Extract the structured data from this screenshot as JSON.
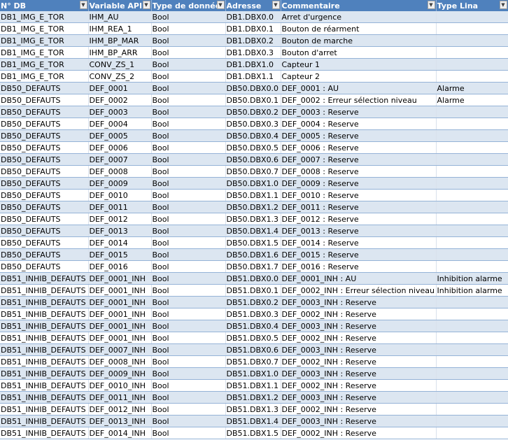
{
  "headers": [
    "N° DB",
    "Variable API",
    "Type de donnée",
    "Adresse",
    "Commentaire",
    "Type Lina"
  ],
  "rows": [
    [
      "DB1_IMG_E_TOR",
      "IHM_AU",
      "Bool",
      "DB1.DBX0.0",
      "Arret d'urgence",
      ""
    ],
    [
      "DB1_IMG_E_TOR",
      "IHM_REA_1",
      "Bool",
      "DB1.DBX0.1",
      "Bouton de réarment",
      ""
    ],
    [
      "DB1_IMG_E_TOR",
      "IHM_BP_MAR",
      "Bool",
      "DB1.DBX0.2",
      "Bouton de marche",
      ""
    ],
    [
      "DB1_IMG_E_TOR",
      "IHM_BP_ARR",
      "Bool",
      "DB1.DBX0.3",
      "Bouton d'arret",
      ""
    ],
    [
      "DB1_IMG_E_TOR",
      "CONV_ZS_1",
      "Bool",
      "DB1.DBX1.0",
      "Capteur 1",
      ""
    ],
    [
      "DB1_IMG_E_TOR",
      "CONV_ZS_2",
      "Bool",
      "DB1.DBX1.1",
      "Capteur 2",
      ""
    ],
    [
      "DB50_DEFAUTS",
      "DEF_0001",
      "Bool",
      "DB50.DBX0.0",
      "DEF_0001 : AU",
      "Alarme"
    ],
    [
      "DB50_DEFAUTS",
      "DEF_0002",
      "Bool",
      "DB50.DBX0.1",
      "DEF_0002 : Erreur sélection niveau",
      "Alarme"
    ],
    [
      "DB50_DEFAUTS",
      "DEF_0003",
      "Bool",
      "DB50.DBX0.2",
      "DEF_0003 : Reserve",
      ""
    ],
    [
      "DB50_DEFAUTS",
      "DEF_0004",
      "Bool",
      "DB50.DBX0.3",
      "DEF_0004 : Reserve",
      ""
    ],
    [
      "DB50_DEFAUTS",
      "DEF_0005",
      "Bool",
      "DB50.DBX0.4",
      "DEF_0005 : Reserve",
      ""
    ],
    [
      "DB50_DEFAUTS",
      "DEF_0006",
      "Bool",
      "DB50.DBX0.5",
      "DEF_0006 : Reserve",
      ""
    ],
    [
      "DB50_DEFAUTS",
      "DEF_0007",
      "Bool",
      "DB50.DBX0.6",
      "DEF_0007 : Reserve",
      ""
    ],
    [
      "DB50_DEFAUTS",
      "DEF_0008",
      "Bool",
      "DB50.DBX0.7",
      "DEF_0008 : Reserve",
      ""
    ],
    [
      "DB50_DEFAUTS",
      "DEF_0009",
      "Bool",
      "DB50.DBX1.0",
      "DEF_0009 : Reserve",
      ""
    ],
    [
      "DB50_DEFAUTS",
      "DEF_0010",
      "Bool",
      "DB50.DBX1.1",
      "DEF_0010 : Reserve",
      ""
    ],
    [
      "DB50_DEFAUTS",
      "DEF_0011",
      "Bool",
      "DB50.DBX1.2",
      "DEF_0011 : Reserve",
      ""
    ],
    [
      "DB50_DEFAUTS",
      "DEF_0012",
      "Bool",
      "DB50.DBX1.3",
      "DEF_0012 : Reserve",
      ""
    ],
    [
      "DB50_DEFAUTS",
      "DEF_0013",
      "Bool",
      "DB50.DBX1.4",
      "DEF_0013 : Reserve",
      ""
    ],
    [
      "DB50_DEFAUTS",
      "DEF_0014",
      "Bool",
      "DB50.DBX1.5",
      "DEF_0014 : Reserve",
      ""
    ],
    [
      "DB50_DEFAUTS",
      "DEF_0015",
      "Bool",
      "DB50.DBX1.6",
      "DEF_0015 : Reserve",
      ""
    ],
    [
      "DB50_DEFAUTS",
      "DEF_0016",
      "Bool",
      "DB50.DBX1.7",
      "DEF_0016 : Reserve",
      ""
    ],
    [
      "DB51_INHIB_DEFAUTS",
      "DEF_0001_INH",
      "Bool",
      "DB51.DBX0.0",
      "DEF_0001_INH : AU",
      "Inhibition alarme"
    ],
    [
      "DB51_INHIB_DEFAUTS",
      "DEF_0001_INH",
      "Bool",
      "DB51.DBX0.1",
      "DEF_0002_INH : Erreur sélection niveau",
      "Inhibition alarme"
    ],
    [
      "DB51_INHIB_DEFAUTS",
      "DEF_0001_INH",
      "Bool",
      "DB51.DBX0.2",
      "DEF_0003_INH : Reserve",
      ""
    ],
    [
      "DB51_INHIB_DEFAUTS",
      "DEF_0001_INH",
      "Bool",
      "DB51.DBX0.3",
      "DEF_0002_INH : Reserve",
      ""
    ],
    [
      "DB51_INHIB_DEFAUTS",
      "DEF_0001_INH",
      "Bool",
      "DB51.DBX0.4",
      "DEF_0003_INH : Reserve",
      ""
    ],
    [
      "DB51_INHIB_DEFAUTS",
      "DEF_0001_INH",
      "Bool",
      "DB51.DBX0.5",
      "DEF_0002_INH : Reserve",
      ""
    ],
    [
      "DB51_INHIB_DEFAUTS",
      "DEF_0007_INH",
      "Bool",
      "DB51.DBX0.6",
      "DEF_0003_INH : Reserve",
      ""
    ],
    [
      "DB51_INHIB_DEFAUTS",
      "DEF_0008_INH",
      "Bool",
      "DB51.DBX0.7",
      "DEF_0002_INH : Reserve",
      ""
    ],
    [
      "DB51_INHIB_DEFAUTS",
      "DEF_0009_INH",
      "Bool",
      "DB51.DBX1.0",
      "DEF_0003_INH : Reserve",
      ""
    ],
    [
      "DB51_INHIB_DEFAUTS",
      "DEF_0010_INH",
      "Bool",
      "DB51.DBX1.1",
      "DEF_0002_INH : Reserve",
      ""
    ],
    [
      "DB51_INHIB_DEFAUTS",
      "DEF_0011_INH",
      "Bool",
      "DB51.DBX1.2",
      "DEF_0003_INH : Reserve",
      ""
    ],
    [
      "DB51_INHIB_DEFAUTS",
      "DEF_0012_INH",
      "Bool",
      "DB51.DBX1.3",
      "DEF_0002_INH : Reserve",
      ""
    ],
    [
      "DB51_INHIB_DEFAUTS",
      "DEF_0013_INH",
      "Bool",
      "DB51.DBX1.4",
      "DEF_0003_INH : Reserve",
      ""
    ],
    [
      "DB51_INHIB_DEFAUTS",
      "DEF_0014_INH",
      "Bool",
      "DB51.DBX1.5",
      "DEF_0002_INH : Reserve",
      ""
    ]
  ],
  "colors": {
    "header_bg": "#4f81bd",
    "band_bg": "#dce6f1",
    "row_border": "#95b3d7"
  },
  "icons": {
    "filter": "filter-dropdown-icon"
  }
}
